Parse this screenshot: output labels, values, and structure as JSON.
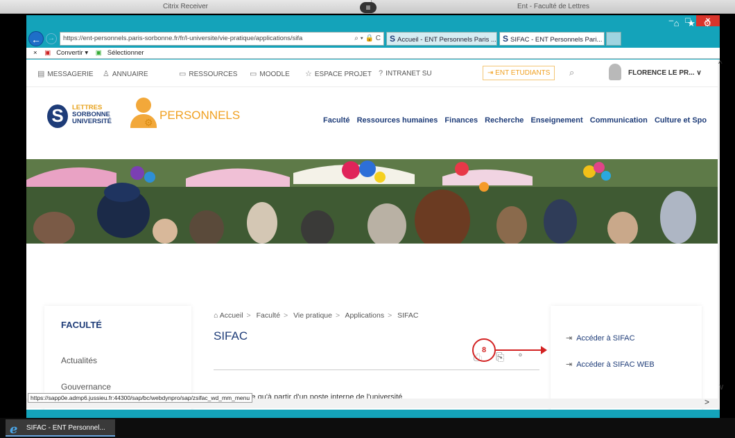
{
  "citrix": {
    "left_title": "Citrix Receiver",
    "right_title": "Ent - Faculté de Lettres",
    "handle": "≡"
  },
  "window": {
    "minimize": "–",
    "maximize": "□",
    "close": "×"
  },
  "browser": {
    "back": "←",
    "forward": "→",
    "url": "https://ent-personnels.paris-sorbonne.fr/fr/l-universite/vie-pratique/applications/sifa",
    "address_icons": "⌕ ▾ 🔒 C",
    "tabs": [
      {
        "logo": "S",
        "label": "Accueil - ENT Personnels Paris ..."
      },
      {
        "logo": "S",
        "label": "SIFAC - ENT Personnels Pari... ×"
      }
    ],
    "top_right_icons": "⌂ ★ ⚙",
    "command_bar": {
      "close": "×",
      "convertir": "Convertir ▾",
      "selectionner": "Sélectionner"
    }
  },
  "ent_topbar": {
    "items": [
      {
        "icon": "▤",
        "label": "MESSAGERIE"
      },
      {
        "icon": "♙",
        "label": "ANNUAIRE"
      },
      {
        "icon": "▭",
        "label": "RESSOURCES"
      },
      {
        "icon": "▭",
        "label": "MOODLE"
      },
      {
        "icon": "☆",
        "label": "ESPACE PROJET"
      },
      {
        "icon": "?",
        "label": "INTRANET SU"
      }
    ],
    "ent_etudiants": "ENT ETUDIANTS",
    "ent_etudiants_icon": "⇥",
    "search_icon": "⌕",
    "username": "FLORENCE LE PR...",
    "username_chevron": "∨"
  },
  "logo": {
    "line1": "LETTRES",
    "line2": "SORBONNE",
    "line3": "UNIVERSITÉ",
    "personnels": "PERSONNELS"
  },
  "main_nav": [
    "Faculté",
    "Ressources humaines",
    "Finances",
    "Recherche",
    "Enseignement",
    "Communication",
    "Culture et Spo"
  ],
  "sidebar": {
    "title": "FACULTÉ",
    "links": [
      "Actualités",
      "Gouvernance"
    ]
  },
  "content": {
    "breadcrumb": [
      "Accueil",
      "Faculté",
      "Vie pratique",
      "Applications",
      "SIFAC"
    ],
    "home_icon": "⌂",
    "separator": ">",
    "title": "SIFAC",
    "tool_icons": "⎙ ⎘ °",
    "intro": "peut se faire qu'à partir d'un poste interne de l'université"
  },
  "right_panel": {
    "links": [
      {
        "icon": "⇥",
        "label": "Accéder à SIFAC"
      },
      {
        "icon": "⇥",
        "label": "Accéder à SIFAC WEB"
      }
    ]
  },
  "annotation": {
    "number": "8",
    "color": "#d32222"
  },
  "status_bar_url": "https://sapp0e.admp6.jussieu.fr:44300/sap/bc/webdynpro/sap/zsifac_wd_mm_menu",
  "scroll": {
    "up": "^",
    "down": "∨",
    "right": ">"
  },
  "taskbar": {
    "ie_icon": "e",
    "label": "SIFAC - ENT Personnel..."
  },
  "colors": {
    "ie_frame": "#14a3ba",
    "brand_blue": "#1e3c78",
    "brand_orange": "#f0a020"
  }
}
